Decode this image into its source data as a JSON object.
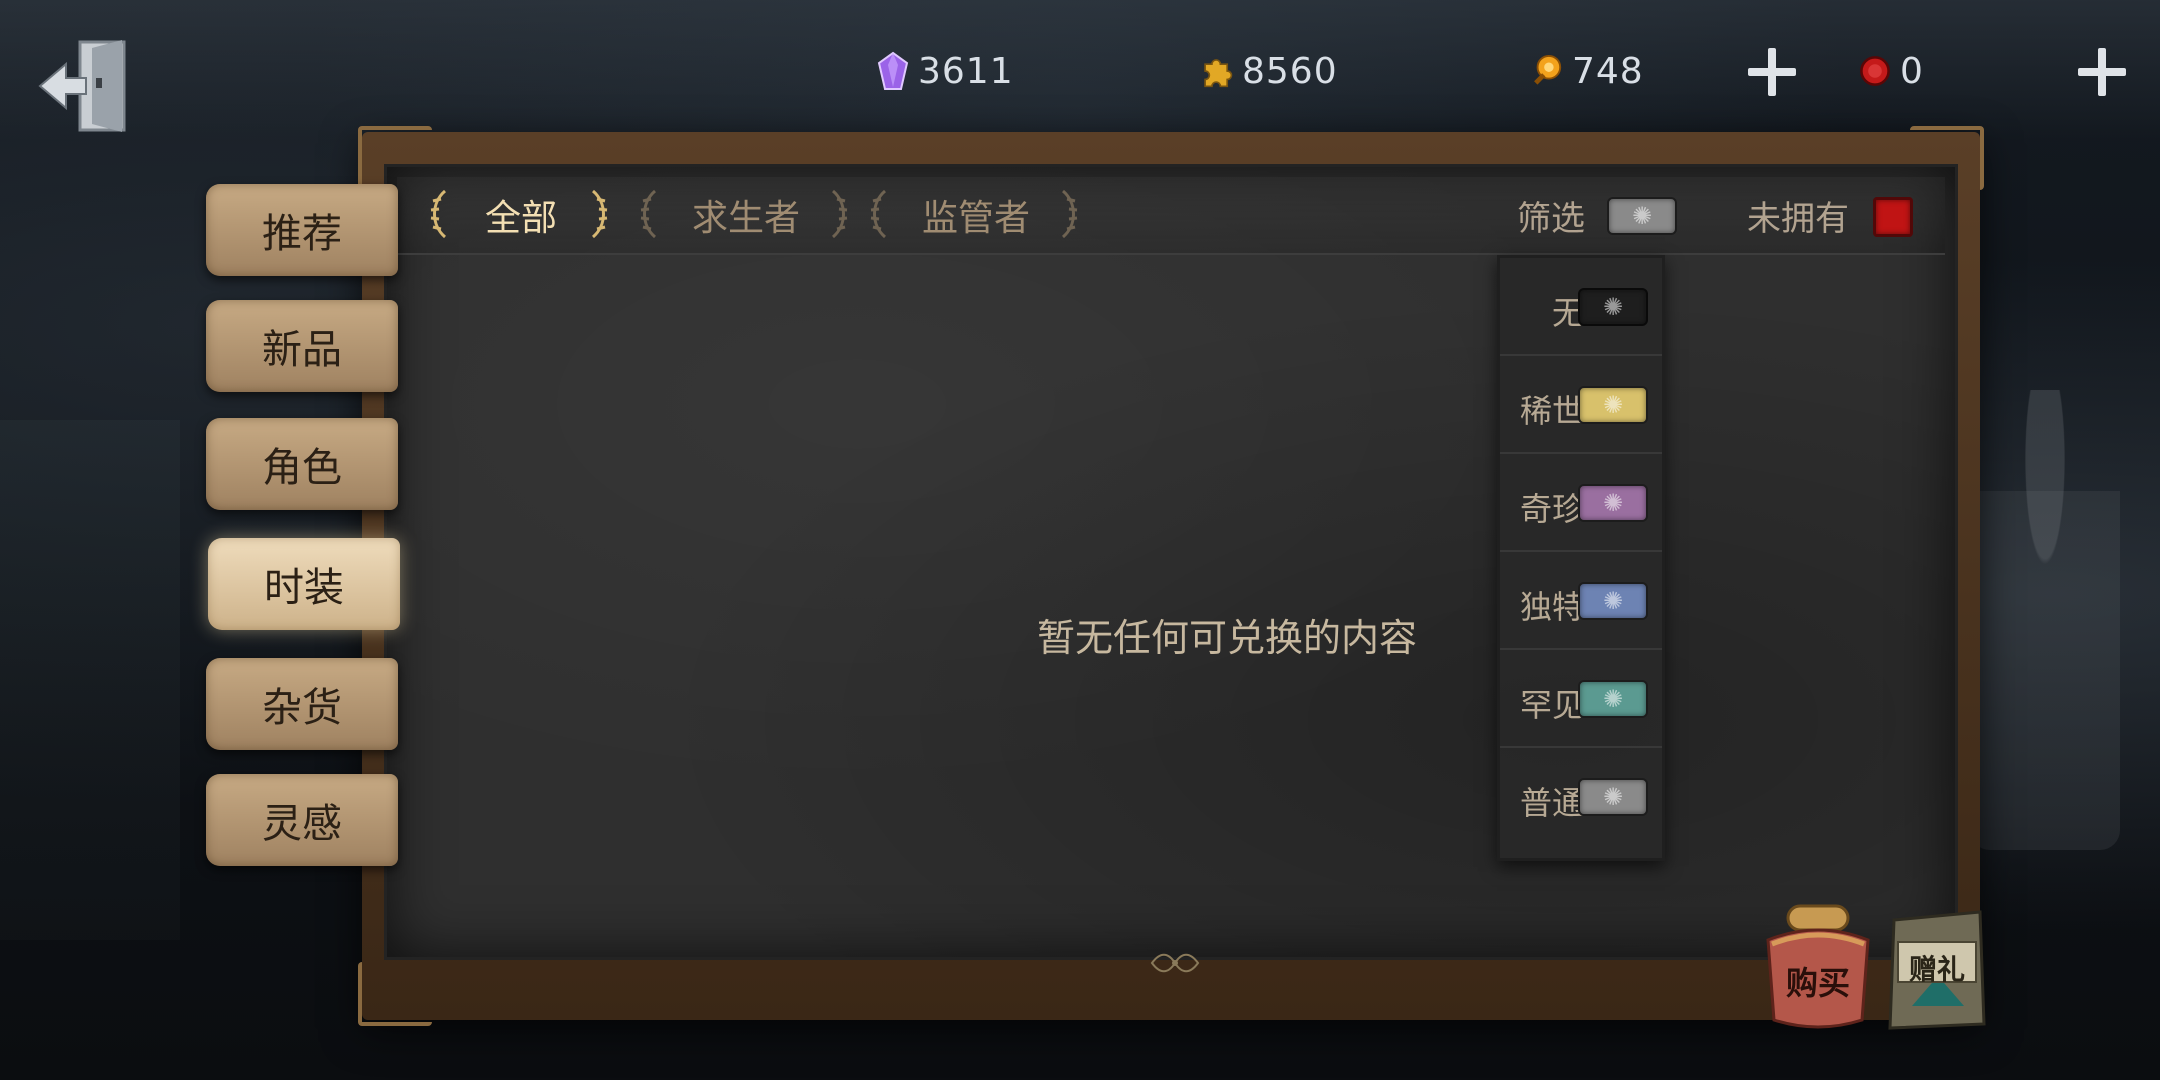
{
  "currencies": [
    {
      "name": "purple-gem",
      "value": "3611",
      "color": "#9b63e8"
    },
    {
      "name": "puzzle-piece",
      "value": "8560",
      "color": "#e2a825"
    },
    {
      "name": "orange-clue",
      "value": "748",
      "color": "#f3a21c"
    },
    {
      "name": "red-coin",
      "value": "0",
      "color": "#c41a1a"
    }
  ],
  "side_menu": [
    {
      "label": "推荐",
      "active": false
    },
    {
      "label": "新品",
      "active": false
    },
    {
      "label": "角色",
      "active": false
    },
    {
      "label": "时装",
      "active": true
    },
    {
      "label": "杂货",
      "active": false
    },
    {
      "label": "灵感",
      "active": false
    }
  ],
  "category_tabs": [
    {
      "label": "全部",
      "active": true
    },
    {
      "label": "求生者",
      "active": false
    },
    {
      "label": "监管者",
      "active": false
    }
  ],
  "filter": {
    "label": "筛选"
  },
  "unowned": {
    "label": "未拥有",
    "checked": true
  },
  "rarity_options": [
    {
      "label": "无",
      "color": "#1e1e1e"
    },
    {
      "label": "稀世",
      "color": "#d8c16b"
    },
    {
      "label": "奇珍",
      "color": "#9a6fa0"
    },
    {
      "label": "独特",
      "color": "#6d83b3"
    },
    {
      "label": "罕见",
      "color": "#5b9a91"
    },
    {
      "label": "普通",
      "color": "#8a8a8a"
    }
  ],
  "empty_message": "暂无任何可兑换的内容",
  "buy_button": {
    "label": "购买"
  },
  "gift_button": {
    "label": "赠礼"
  }
}
